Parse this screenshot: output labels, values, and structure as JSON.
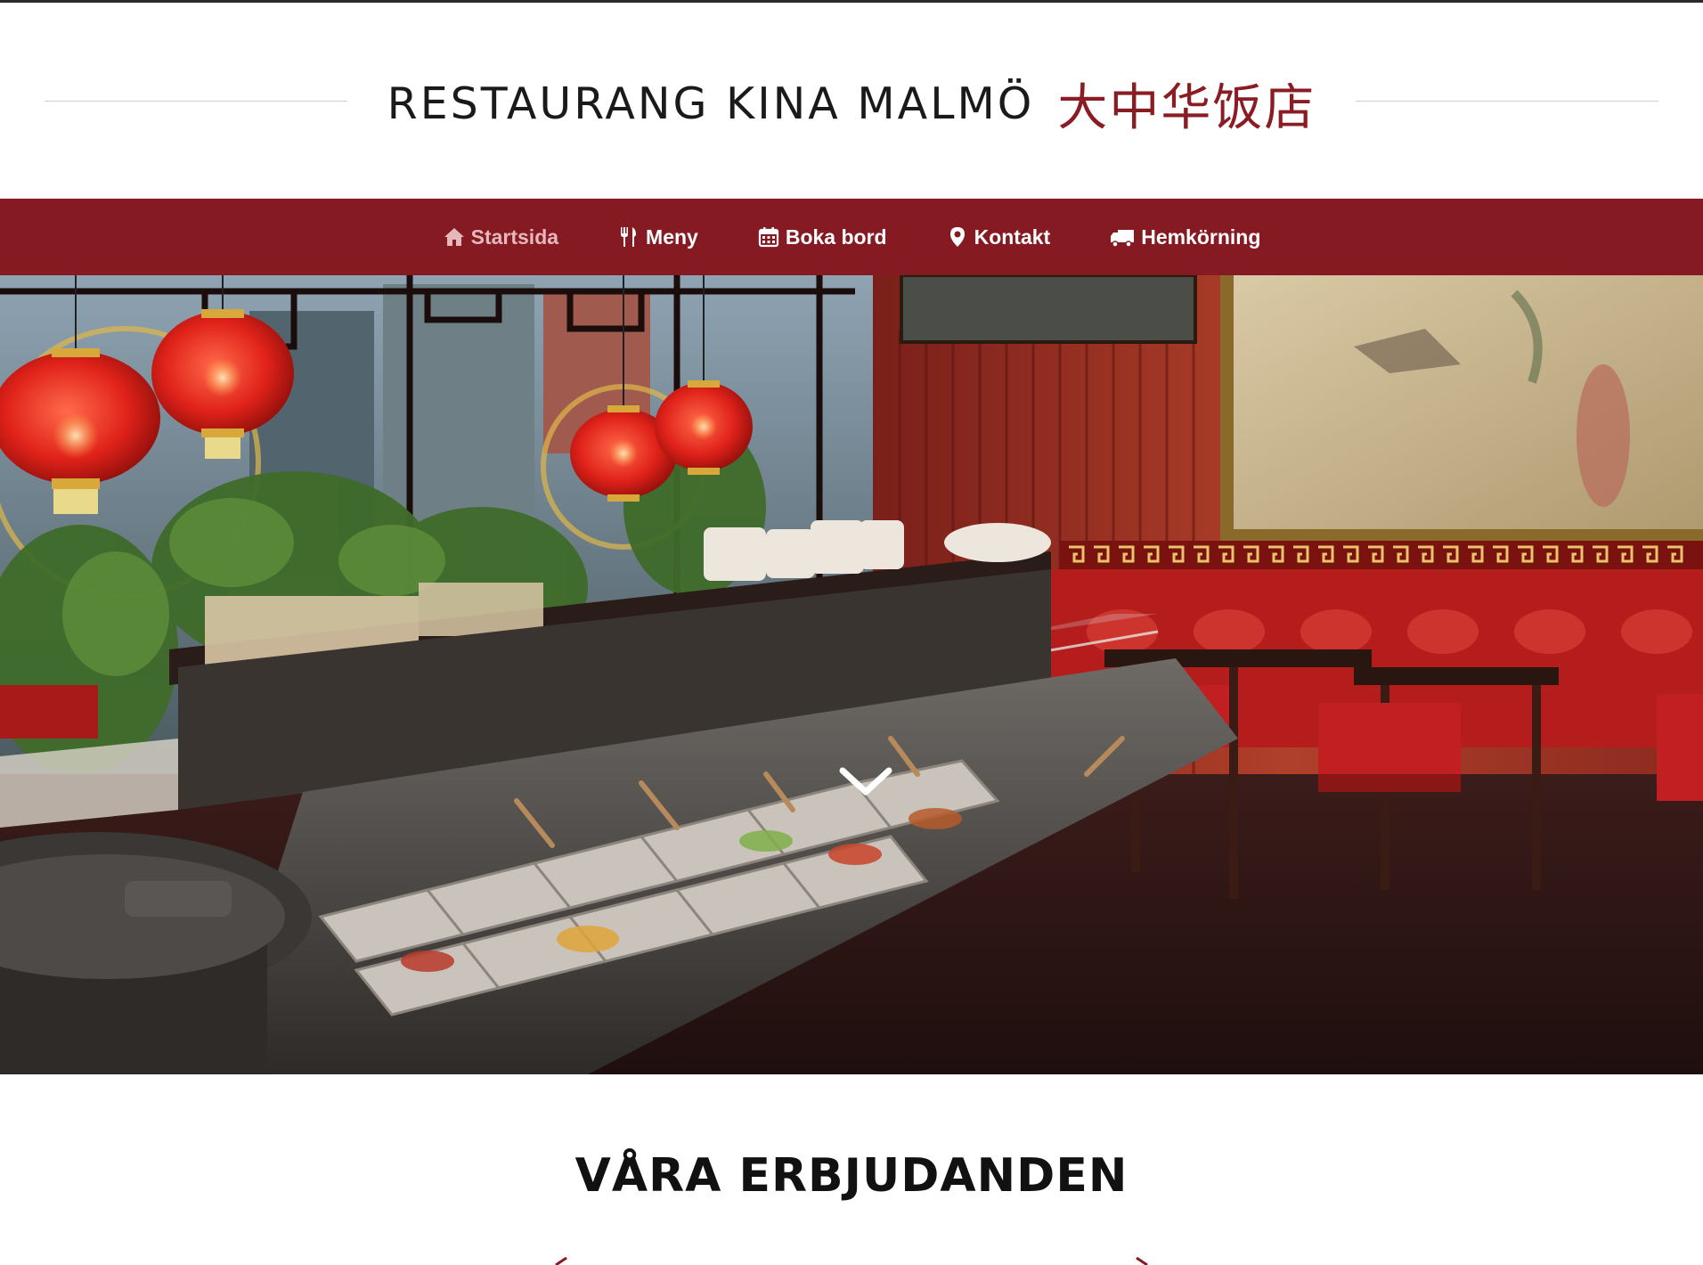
{
  "header": {
    "name": "RESTAURANG KINA MALMÖ",
    "chinese_name": "大中华饭店"
  },
  "nav": {
    "items": [
      {
        "label": "Startsida",
        "icon": "home-icon",
        "active": true
      },
      {
        "label": "Meny",
        "icon": "utensils-icon",
        "active": false
      },
      {
        "label": "Boka bord",
        "icon": "calendar-icon",
        "active": false
      },
      {
        "label": "Kontakt",
        "icon": "map-marker-icon",
        "active": false
      },
      {
        "label": "Hemkörning",
        "icon": "truck-icon",
        "active": false
      }
    ]
  },
  "hero": {
    "scroll_icon": "chevron-down-icon"
  },
  "offers": {
    "title": "VÅRA ERBJUDANDEN"
  },
  "colors": {
    "brand_red": "#861a23",
    "nav_text": "#ffffff",
    "nav_active": "#e7b8bb",
    "chinese_text": "#8a1c24"
  }
}
